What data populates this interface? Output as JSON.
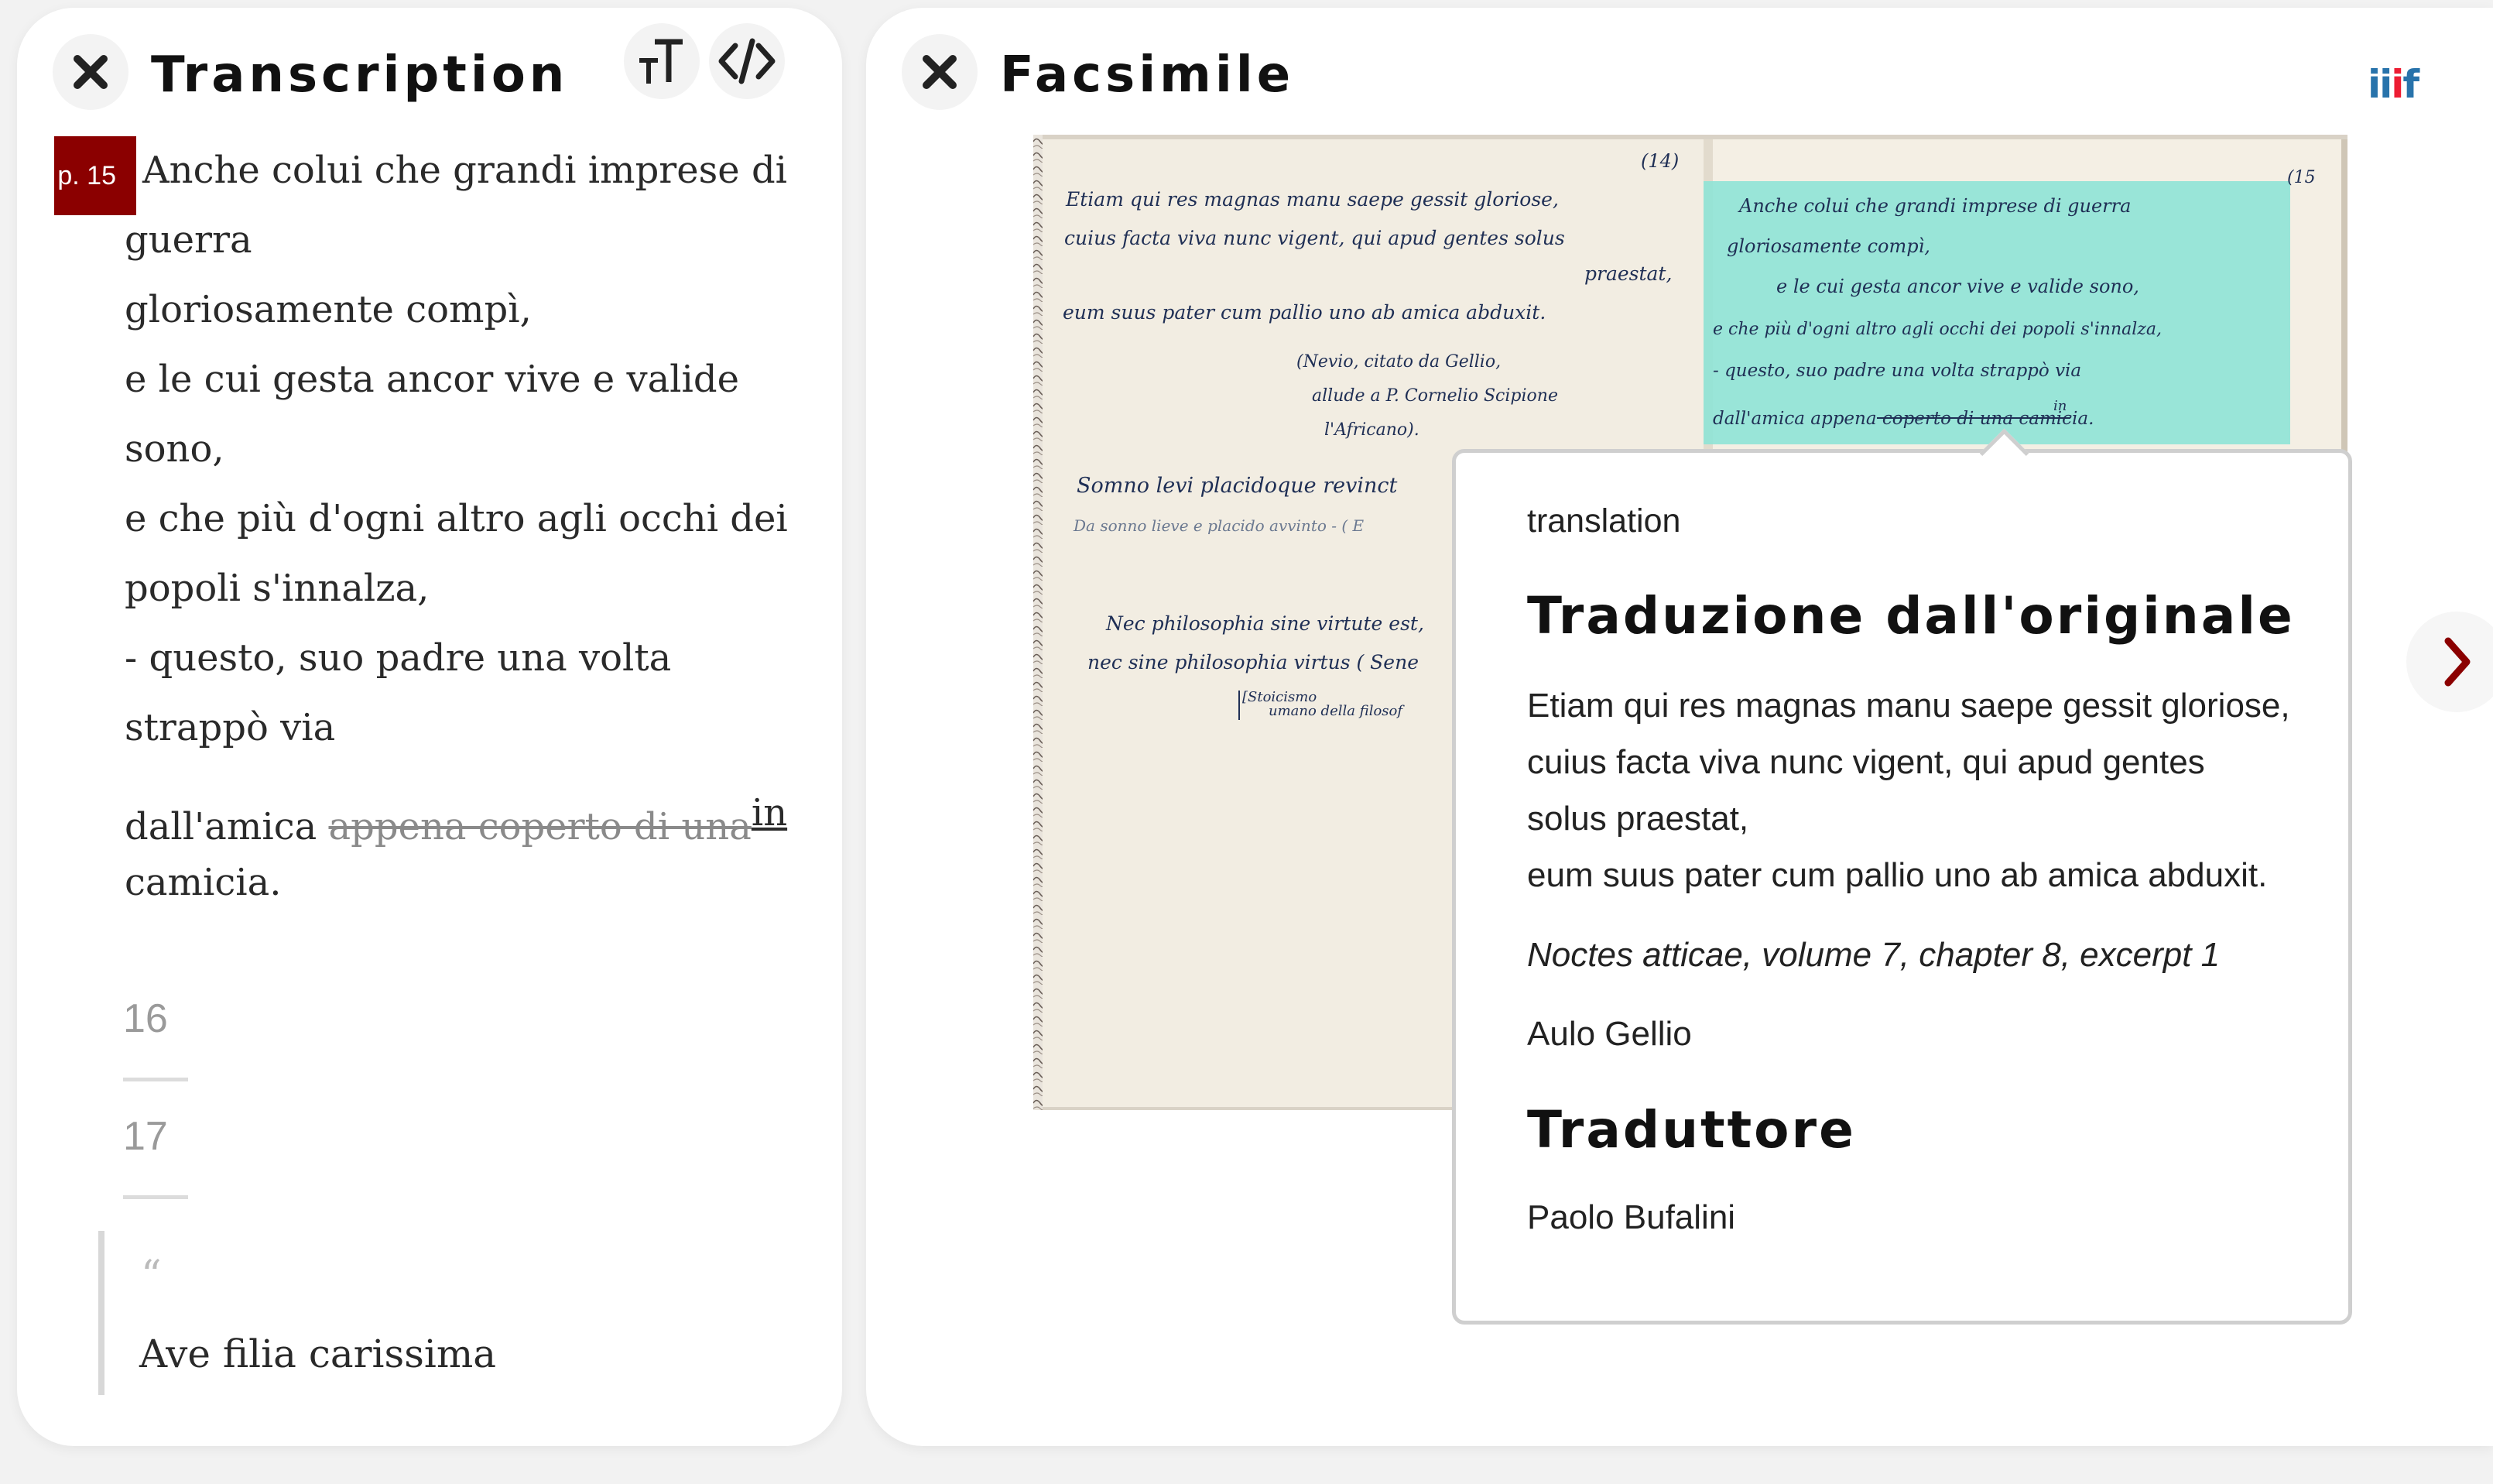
{
  "transcription": {
    "title": "Transcription",
    "page_badge": "p. 15",
    "lines": [
      "Anche colui che grandi imprese di",
      "guerra",
      "gloriosamente compì,",
      "e le cui gesta ancor vive e valide",
      "sono,",
      "e che più d'ogni altro agli occhi dei",
      "popoli s'innalza,",
      "- questo, suo padre una volta",
      "strappò via"
    ],
    "last_line": {
      "before": "dall'amica ",
      "deleted": "appena coperto di una",
      "inserted": "in"
    },
    "final_line": "camicia.",
    "page_numbers": [
      "16",
      "17"
    ],
    "quote_mark": "“",
    "quote_text": "Ave filia carissima"
  },
  "facsimile": {
    "title": "Facsimile",
    "iiif_label": "iiif",
    "manuscript": {
      "page_left_number": "(14)",
      "page_right_number": "(15",
      "left_lines": [
        "Etiam qui res magnas manu saepe gessit gloriose,",
        "cuius facta viva nunc vigent, qui apud gentes solus",
        "praestat,",
        "eum suus pater cum pallio uno ab amica abduxit.",
        "(Nevio, citato da Gellio,",
        "allude a P. Cornelio Scipione",
        "l'Africano).",
        "Somno levi placidoque revinct",
        "Da sonno lieve e placido avvinto -   ( E",
        "Nec philosophia sine virtute est,",
        "nec sine philosophia virtus   ( Sene",
        "[Stoicismo",
        "umano della filosof"
      ],
      "right_lines": [
        "Anche colui che grandi imprese di guerra",
        "gloriosamente compì,",
        "e le cui gesta ancor vive e valide sono,",
        "e che più d'ogni altro agli occhi dei popoli s'innalza,",
        "- questo, suo padre una volta strappò via",
        "dall'amica appena coperto di una camicia."
      ],
      "right_insert": "in"
    },
    "popup": {
      "label": "translation",
      "heading": "Traduzione dall'originale",
      "body_lines": [
        "Etiam qui res magnas manu saepe gessit gloriose,",
        "cuius facta viva nunc vigent, qui apud gentes",
        "solus praestat,",
        "eum suus pater cum pallio uno ab amica abduxit."
      ],
      "source": "Noctes atticae, volume 7, chapter 8, excerpt 1",
      "author": "Aulo Gellio",
      "translator_heading": "Traduttore",
      "translator": "Paolo Bufalini"
    },
    "nav": {
      "prev_icon": "chevron-left-icon",
      "next_icon": "chevron-right-icon"
    }
  },
  "colors": {
    "accent": "#8b0000",
    "highlight": "#8fe3d6",
    "iiif_blue": "#2873ab",
    "iiif_red": "#ed1d33"
  }
}
